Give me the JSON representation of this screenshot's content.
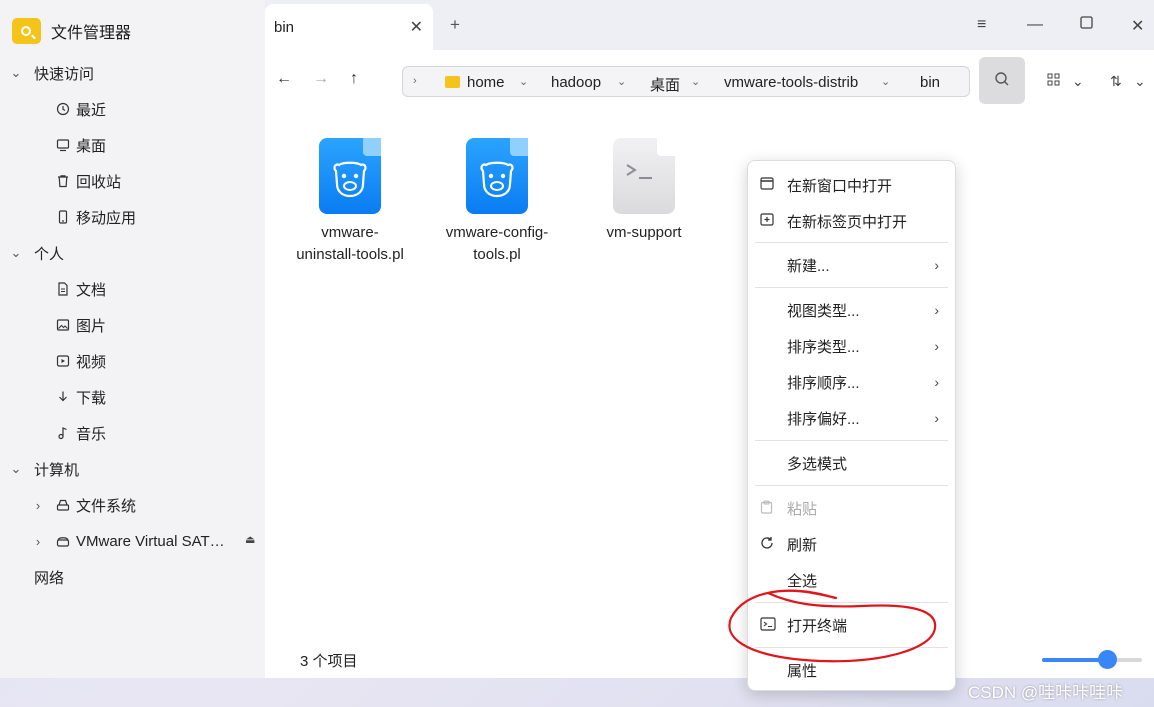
{
  "app": {
    "title": "文件管理器"
  },
  "sidebar": {
    "groups": [
      {
        "label": "快速访问",
        "items": [
          "最近",
          "桌面",
          "回收站",
          "移动应用"
        ]
      },
      {
        "label": "个人",
        "items": [
          "文档",
          "图片",
          "视频",
          "下载",
          "音乐"
        ]
      },
      {
        "label": "计算机",
        "items": [
          "文件系统",
          "VMware Virtual SAT…"
        ]
      }
    ],
    "network": "网络"
  },
  "tabs": [
    {
      "label": "bin"
    }
  ],
  "tab_add": "+",
  "toolbar": {
    "path": [
      "home",
      "hadoop",
      "桌面",
      "vmware-tools-distrib",
      "bin"
    ]
  },
  "files": [
    {
      "name_line1": "vmware-",
      "name_line2": "uninstall-tools.pl",
      "icon": "perl-script-icon"
    },
    {
      "name_line1": "vmware-config-",
      "name_line2": "tools.pl",
      "icon": "perl-script-icon"
    },
    {
      "name_line1": "vm-support",
      "name_line2": "",
      "icon": "shell-script-icon"
    }
  ],
  "status": {
    "item_count": "3 个项目"
  },
  "zoom": {
    "level_fraction": 0.66,
    "accent": "#3b86f7"
  },
  "context_menu": {
    "items": {
      "open_new_window": "在新窗口中打开",
      "open_new_tab": "在新标签页中打开",
      "new": "新建...",
      "view_type": "视图类型...",
      "sort_type": "排序类型...",
      "sort_order": "排序顺序...",
      "sort_pref": "排序偏好...",
      "multi_select": "多选模式",
      "paste": "粘贴",
      "refresh": "刷新",
      "select_all": "全选",
      "open_terminal": "打开终端",
      "properties": "属性"
    }
  },
  "annotation": {
    "color": "#e0161b"
  },
  "watermark": "CSDN @哇咔咔哇咔"
}
